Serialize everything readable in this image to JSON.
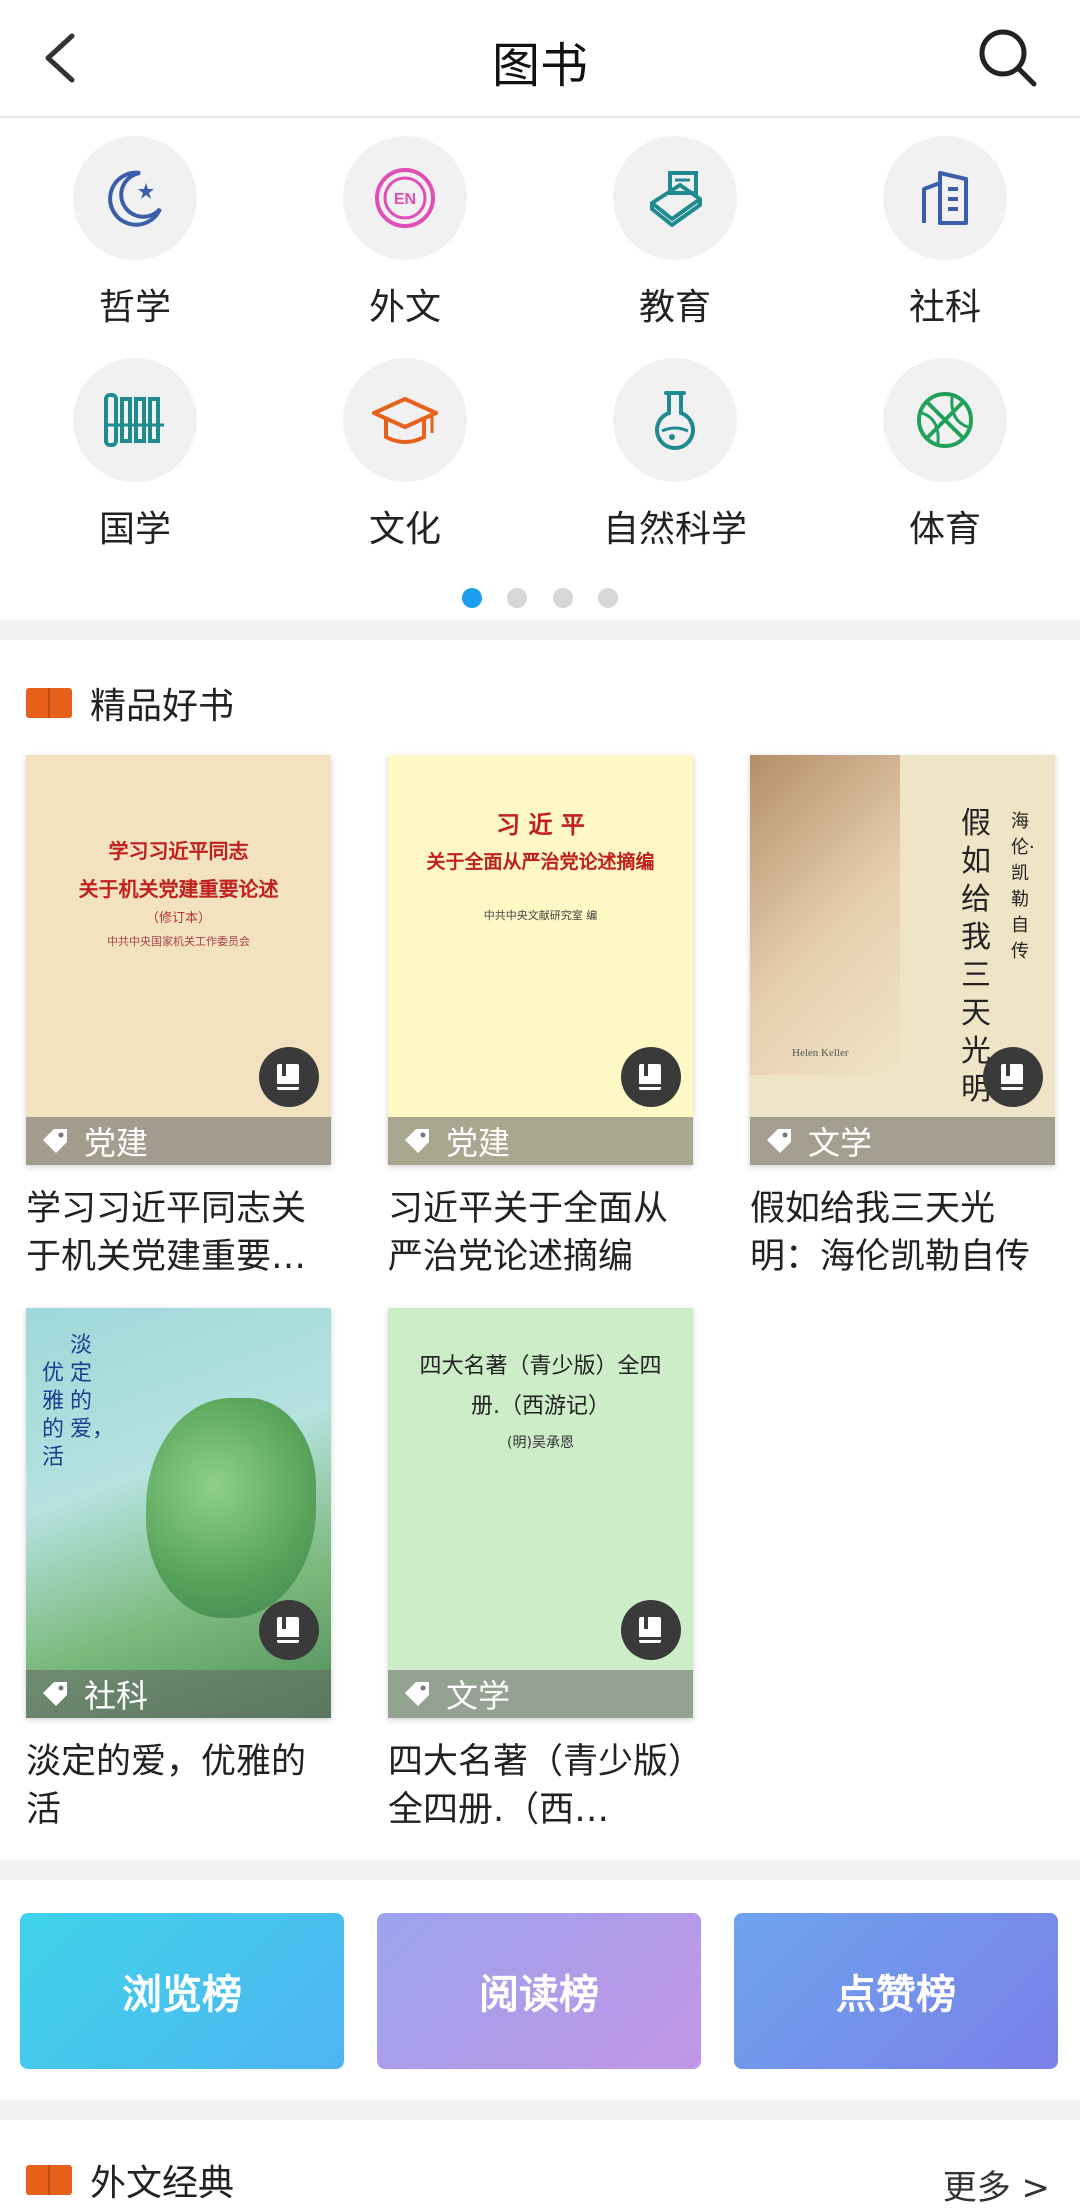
{
  "header": {
    "title": "图书"
  },
  "categories": [
    {
      "label": "哲学",
      "icon": "moon-star-icon"
    },
    {
      "label": "外文",
      "icon": "eng-badge-icon"
    },
    {
      "label": "教育",
      "icon": "book-icon"
    },
    {
      "label": "社科",
      "icon": "building-icon"
    },
    {
      "label": "国学",
      "icon": "bamboo-scroll-icon"
    },
    {
      "label": "文化",
      "icon": "graduation-cap-icon"
    },
    {
      "label": "自然科学",
      "icon": "flask-icon"
    },
    {
      "label": "体育",
      "icon": "basketball-icon"
    }
  ],
  "pager": {
    "total": 4,
    "active": 0
  },
  "featured": {
    "title": "精品好书",
    "books": [
      {
        "tag": "党建",
        "title": "学习习近平同志关于机关党建重要…",
        "cover_title_line1": "学习习近平同志",
        "cover_title_line2": "关于机关党建重要论述",
        "cover_note": "（修订本）",
        "cover_author": "中共中央国家机关工作委员会"
      },
      {
        "tag": "党建",
        "title": "习近平关于全面从严治党论述摘编",
        "cover_title_line1": "习 近 平",
        "cover_title_line2": "关于全面从严治党论述摘编",
        "cover_author": "中共中央文献研究室 编"
      },
      {
        "tag": "文学",
        "title": "假如给我三天光明：海伦凯勒自传",
        "cover_title_line1": "假如给我三天光明",
        "cover_title_line2": "海伦·凯勒自传",
        "cover_author": "Helen Keller"
      },
      {
        "tag": "社科",
        "title": "淡定的爱，优雅的活",
        "cover_title_line1": "淡定的爱，",
        "cover_title_line2": "优雅的活"
      },
      {
        "tag": "文学",
        "title": "四大名著（青少版）全四册.（西…",
        "cover_title_line1": "四大名著（青少版）全四",
        "cover_title_line2": "册.（西游记）",
        "cover_author": "(明)吴承恩"
      }
    ]
  },
  "rankings": [
    {
      "label": "浏览榜",
      "color_from": "#3fd3ea",
      "color_to": "#4fb4f1"
    },
    {
      "label": "阅读榜",
      "color_from": "#9ba3ee",
      "color_to": "#c296e4"
    },
    {
      "label": "点赞榜",
      "color_from": "#6ea4ee",
      "color_to": "#7b80e8"
    }
  ],
  "foreign": {
    "title": "外文经典",
    "more": "更多 >"
  },
  "colors": {
    "accent": "#1a9cf0",
    "section_icon": "#e8611c"
  }
}
